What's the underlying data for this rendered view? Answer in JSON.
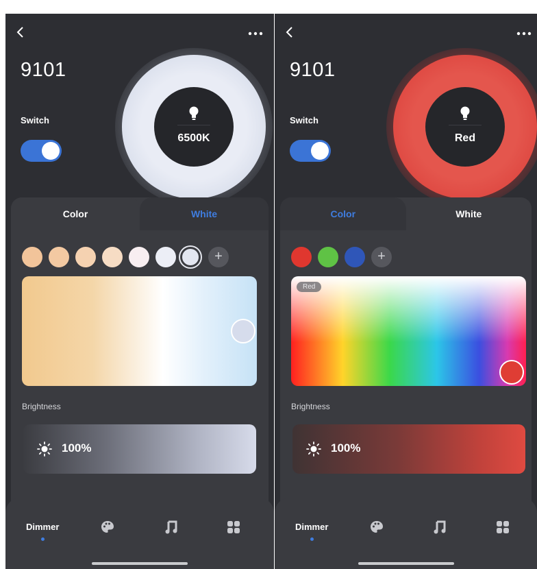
{
  "screens": [
    {
      "device_name": "9101",
      "switch_label": "Switch",
      "ring_label": "6500K",
      "tabs": {
        "color": "Color",
        "white": "White",
        "active": "white"
      },
      "swatches": [
        "#f2c49a",
        "#f3c9a2",
        "#f5d2b1",
        "#f6dcc4",
        "#f8eef1",
        "#eceef6",
        "#e3e6f0"
      ],
      "selected_swatch": 6,
      "picker_tag": "",
      "brightness": {
        "label": "Brightness",
        "value": "100%"
      },
      "nav": {
        "dimmer": "Dimmer",
        "palette_icon": "palette-icon",
        "music_icon": "music-note-icon",
        "scenes_icon": "grid-icon"
      }
    },
    {
      "device_name": "9101",
      "switch_label": "Switch",
      "ring_label": "Red",
      "tabs": {
        "color": "Color",
        "white": "White",
        "active": "color"
      },
      "swatches": [
        "#e0372f",
        "#5fc245",
        "#2f56b8"
      ],
      "selected_swatch": -1,
      "picker_tag": "Red",
      "brightness": {
        "label": "Brightness",
        "value": "100%"
      },
      "nav": {
        "dimmer": "Dimmer",
        "palette_icon": "palette-icon",
        "music_icon": "music-note-icon",
        "scenes_icon": "grid-icon"
      }
    }
  ],
  "colors": {
    "accent": "#3f7de0",
    "background": "#2d2e33",
    "panel": "#3a3b40",
    "selected_red": "#df4a41"
  }
}
